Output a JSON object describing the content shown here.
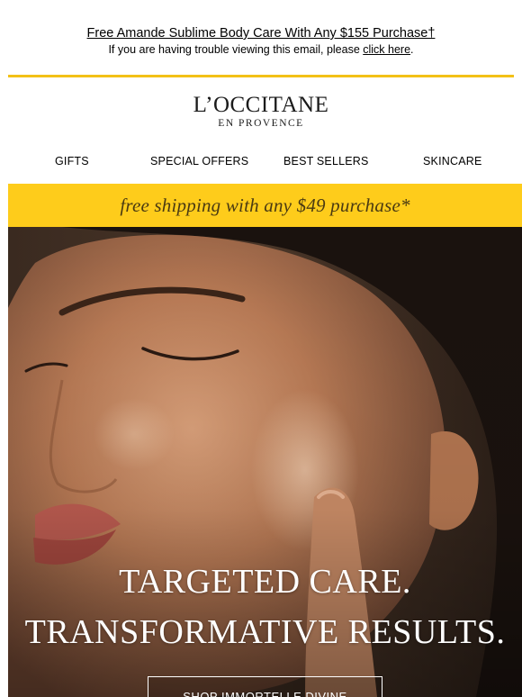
{
  "preheader": {
    "promo": "Free Amande Sublime Body Care With Any $155 Purchase†",
    "trouble_text": "If you are having trouble viewing this email, please ",
    "trouble_link": "click here",
    "trouble_end": "."
  },
  "brand": {
    "name": "L’OCCITANE",
    "sub": "EN PROVENCE",
    "accent_color": "#f3c117"
  },
  "nav": {
    "items": [
      {
        "label": "GIFTS"
      },
      {
        "label": "SPECIAL OFFERS"
      },
      {
        "label": "BEST SELLERS"
      },
      {
        "label": "SKINCARE"
      }
    ]
  },
  "shipping_banner": {
    "text": "free shipping with any $49 purchase*",
    "bg_color": "#fecc1b"
  },
  "hero": {
    "image": "woman-applying-serum-photo",
    "headline_line1": "TARGETED CARE.",
    "headline_line2": "TRANSFORMATIVE RESULTS.",
    "cta_label": "SHOP IMMORTELLE DIVINE"
  }
}
